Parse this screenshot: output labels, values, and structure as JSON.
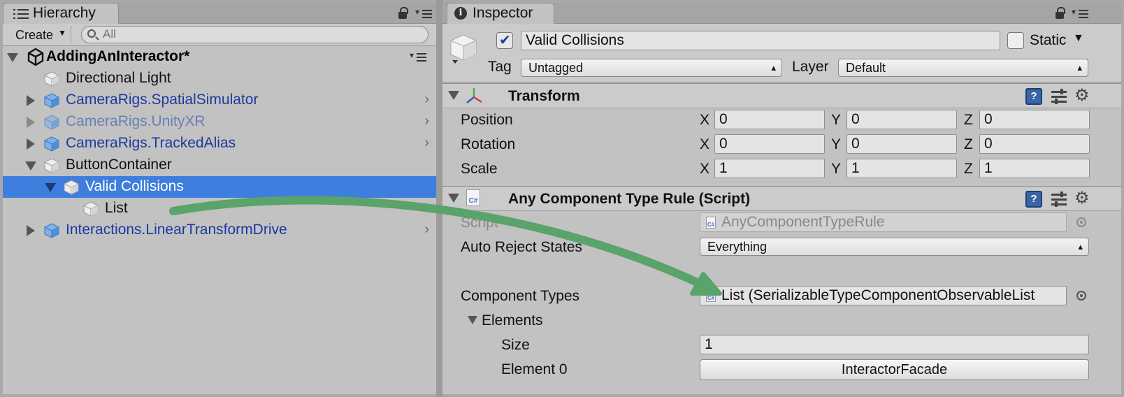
{
  "hierarchy": {
    "tab_label": "Hierarchy",
    "create_label": "Create",
    "search_placeholder": "All",
    "scene": "AddingAnInteractor*",
    "rows": [
      {
        "label": "Directional Light"
      },
      {
        "label": "CameraRigs.SpatialSimulator"
      },
      {
        "label": "CameraRigs.UnityXR"
      },
      {
        "label": "CameraRigs.TrackedAlias"
      },
      {
        "label": "ButtonContainer"
      },
      {
        "label": "Valid Collisions"
      },
      {
        "label": "List"
      },
      {
        "label": "Interactions.LinearTransformDrive"
      }
    ]
  },
  "inspector": {
    "tab_label": "Inspector",
    "object_name": "Valid Collisions",
    "static_label": "Static",
    "tag_label": "Tag",
    "tag_value": "Untagged",
    "layer_label": "Layer",
    "layer_value": "Default",
    "transform": {
      "title": "Transform",
      "rows": [
        {
          "label": "Position",
          "x": "0",
          "y": "0",
          "z": "0"
        },
        {
          "label": "Rotation",
          "x": "0",
          "y": "0",
          "z": "0"
        },
        {
          "label": "Scale",
          "x": "1",
          "y": "1",
          "z": "1"
        }
      ],
      "axis_x": "X",
      "axis_y": "Y",
      "axis_z": "Z"
    },
    "component": {
      "title": "Any Component Type Rule (Script)",
      "script_label": "Script",
      "script_value": "AnyComponentTypeRule",
      "auto_reject_label": "Auto Reject States",
      "auto_reject_value": "Everything",
      "component_types_label": "Component Types",
      "component_types_value": "List (SerializableTypeComponentObservableList",
      "elements_label": "Elements",
      "size_label": "Size",
      "size_value": "1",
      "element0_label": "Element 0",
      "element0_value": "InteractorFacade"
    }
  },
  "colors": {
    "selection": "#3e7ede",
    "prefab_text": "#1c3a9e",
    "arrow": "#5aa36a"
  }
}
